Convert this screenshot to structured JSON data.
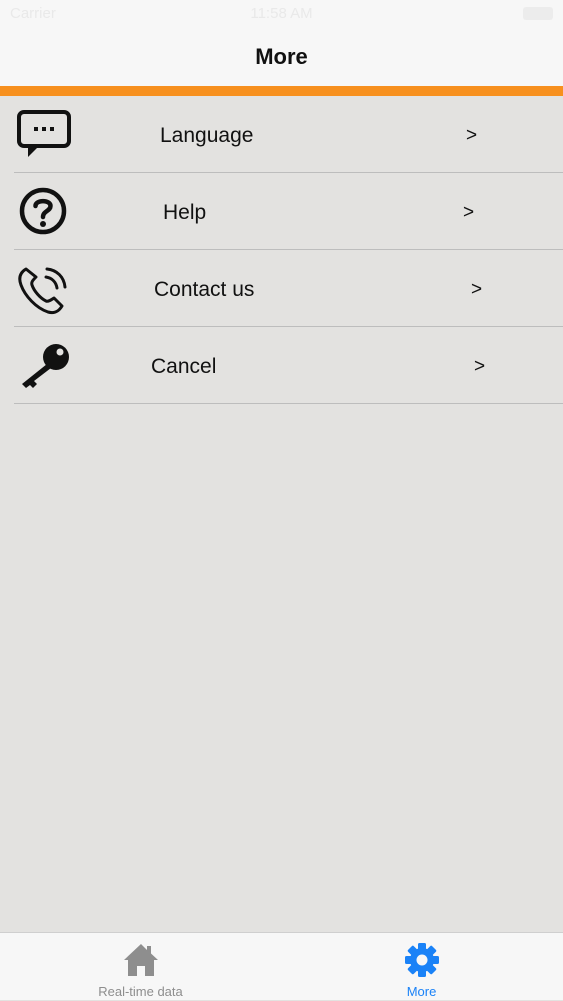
{
  "status_bar": {
    "carrier": "Carrier",
    "time": "11:58 AM"
  },
  "nav": {
    "title": "More"
  },
  "menu": {
    "items": [
      {
        "icon": "chat-bubble-icon",
        "label": "Language",
        "chevron": ">"
      },
      {
        "icon": "question-circle-icon",
        "label": "Help",
        "chevron": ">"
      },
      {
        "icon": "phone-ringing-icon",
        "label": "Contact us",
        "chevron": ">"
      },
      {
        "icon": "key-icon",
        "label": "Cancel",
        "chevron": ">"
      }
    ]
  },
  "tab_bar": {
    "tabs": [
      {
        "icon": "home-icon",
        "label": "Real-time data",
        "active": false
      },
      {
        "icon": "gear-icon",
        "label": "More",
        "active": true
      }
    ]
  },
  "colors": {
    "accent_orange": "#f7901e",
    "active_tab_blue": "#1a82f7",
    "inactive_tab_gray": "#8e8e8e",
    "background": "#e3e2e0"
  }
}
